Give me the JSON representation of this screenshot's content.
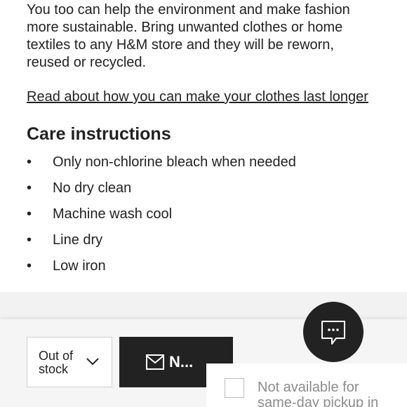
{
  "sustainability": {
    "paragraph": "You too can help the environment and make fashion more sustainable. Bring unwanted clothes or home textiles to any H&M store and they will be reworn, reused or recycled.",
    "link": "Read about how you can make your clothes last longer"
  },
  "care": {
    "title": "Care instructions",
    "bullet": "•",
    "items": [
      "Only non-chlorine bleach when needed",
      "No dry clean",
      "Machine wash cool",
      "Line dry",
      "Low iron"
    ]
  },
  "purchase": {
    "size_select_label": "Out of stock",
    "notify_label": "N..."
  },
  "pickup": {
    "label": "Not available for same-day pickup in"
  },
  "icons": {
    "chevron": "chevron-down-icon",
    "mail": "envelope-icon",
    "chat": "chat-bubble-icon"
  },
  "colors": {
    "text": "#222222",
    "button_bg": "#222222",
    "muted_text": "#8c8c8c",
    "bar_bg": "#f5f5f5"
  }
}
